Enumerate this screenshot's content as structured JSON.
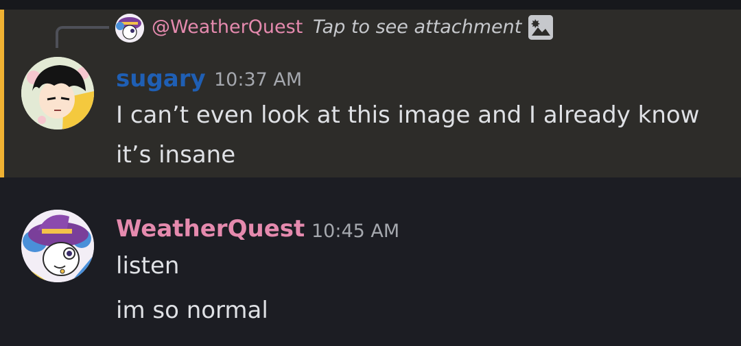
{
  "reply": {
    "mention": "@WeatherQuest",
    "preview": "Tap to see attachment",
    "icon": "image-icon"
  },
  "messages": [
    {
      "author": "sugary",
      "author_color": "#1f5fb4",
      "time": "10:37 AM",
      "lines": [
        "I can’t even look at this image and I already know",
        "it’s insane"
      ]
    },
    {
      "author": "WeatherQuest",
      "author_color": "#e58aae",
      "time": "10:45 AM",
      "lines": [
        "listen",
        "im so normal"
      ]
    }
  ],
  "colors": {
    "background": "#1c1d23",
    "highlight": "#2d2c29",
    "highlight_bar": "#f0b232"
  }
}
